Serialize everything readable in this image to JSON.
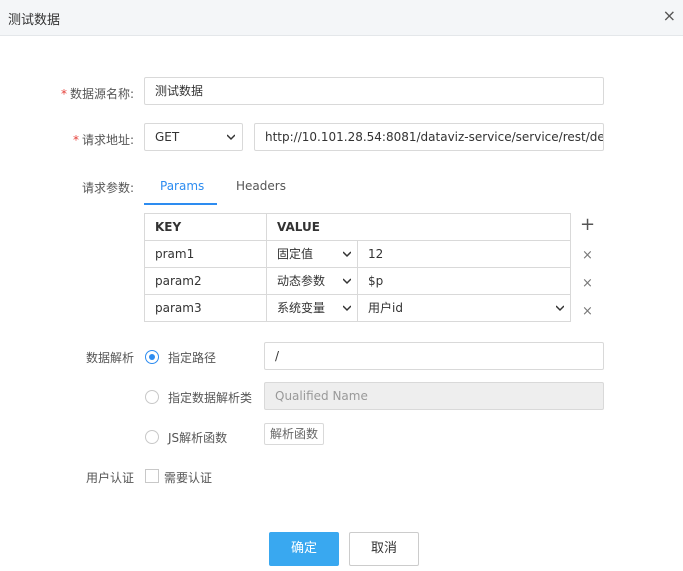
{
  "dialog": {
    "title": "测试数据",
    "close_glyph": "×"
  },
  "form": {
    "name_label": "数据源名称:",
    "name_value": "测试数据",
    "url_label": "请求地址:",
    "method": "GET",
    "url_value": "http://10.101.28.54:8081/dataviz-service/service/rest/den",
    "params_label": "请求参数:",
    "tabs": [
      {
        "label": "Params"
      },
      {
        "label": "Headers"
      }
    ],
    "table": {
      "headers": [
        "KEY",
        "VALUE"
      ],
      "rows": [
        {
          "key": "pram1",
          "type": "固定值",
          "value": "12"
        },
        {
          "key": "param2",
          "type": "动态参数",
          "value": "$p"
        },
        {
          "key": "param3",
          "type": "系统变量",
          "value": "用户id"
        }
      ],
      "add_glyph": "+",
      "remove_glyph": "×"
    },
    "parse_label": "数据解析",
    "parse_options": [
      {
        "label": "指定路径",
        "value": "/"
      },
      {
        "label": "指定数据解析类",
        "placeholder": "Qualified Name"
      },
      {
        "label": "JS解析函数",
        "button": "解析函数"
      }
    ],
    "auth_label": "用户认证",
    "auth_checkbox": "需要认证"
  },
  "footer": {
    "confirm": "确定",
    "cancel": "取消"
  },
  "colors": {
    "accent": "#2d8cf0",
    "primary_button": "#39a8f0",
    "required": "#e5403a"
  }
}
